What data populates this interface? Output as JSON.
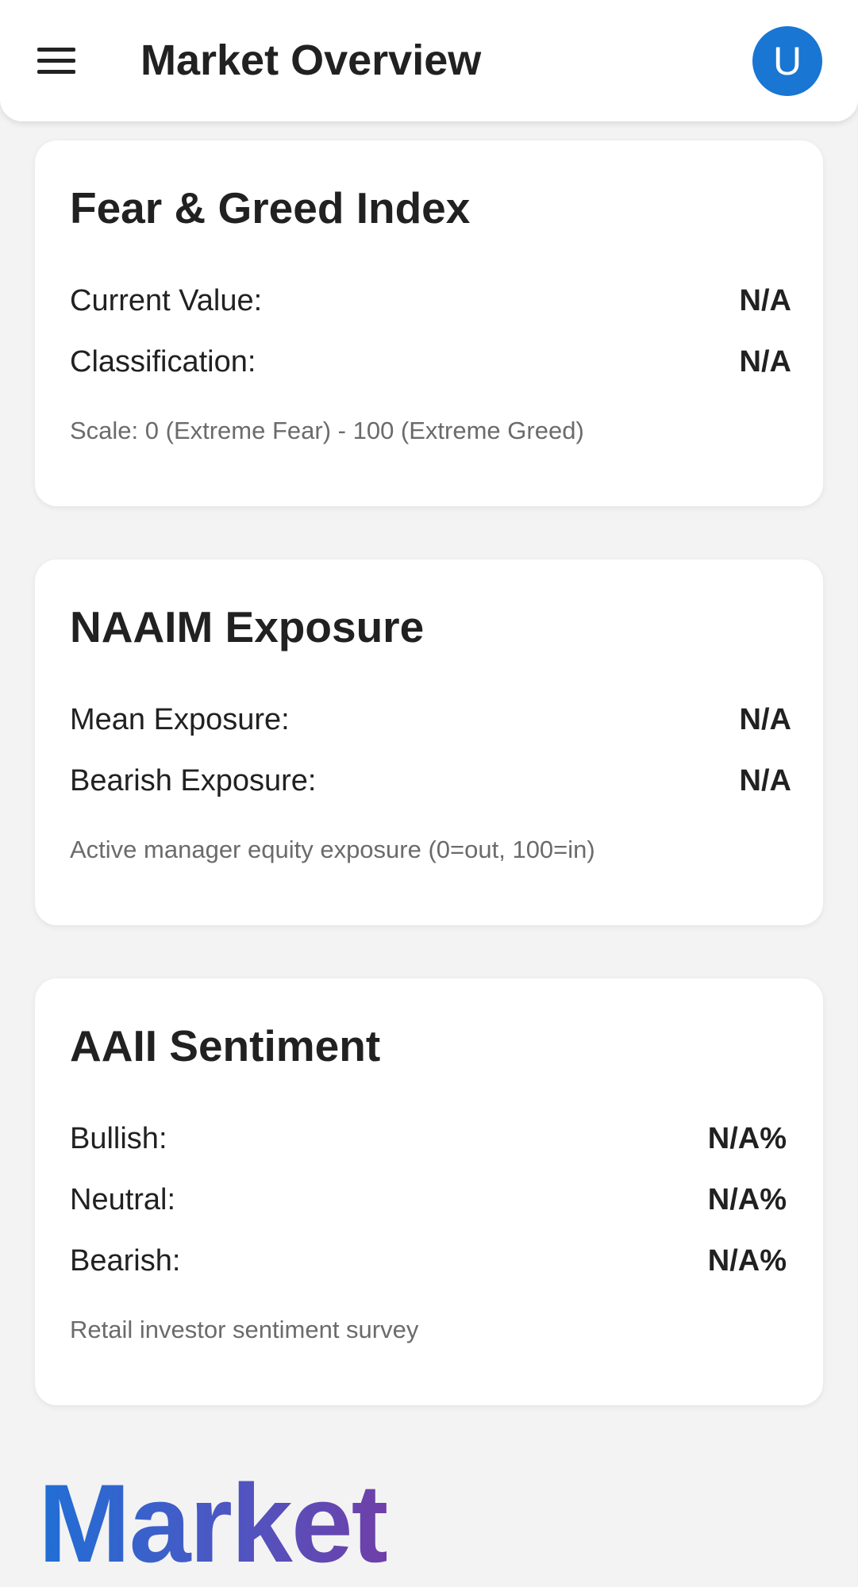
{
  "app_bar": {
    "menu_icon": "menu-icon",
    "title": "Market Overview",
    "avatar_letter": "U"
  },
  "fear_greed": {
    "title": "Fear & Greed Index",
    "rows": [
      {
        "label": "Current Value:",
        "value": "N/A"
      },
      {
        "label": "Classification:",
        "value": "N/A"
      }
    ],
    "note": "Scale: 0 (Extreme Fear) - 100 (Extreme Greed)"
  },
  "naaim": {
    "title": "NAAIM Exposure",
    "rows": [
      {
        "label": "Mean Exposure:",
        "value": "N/A"
      },
      {
        "label": "Bearish Exposure:",
        "value": "N/A"
      }
    ],
    "note": "Active manager equity exposure (0=out, 100=in)"
  },
  "aaii": {
    "title": "AAII Sentiment",
    "rows": [
      {
        "label": "Bullish:",
        "value": "N/A%"
      },
      {
        "label": "Neutral:",
        "value": "N/A%"
      },
      {
        "label": "Bearish:",
        "value": "N/A%"
      }
    ],
    "note": "Retail investor sentiment survey"
  },
  "footer": {
    "brand_text": "Market"
  },
  "colors": {
    "avatar": "#1976d2",
    "brand_gradient_start": "#1f6fd6",
    "brand_gradient_end": "#6f3fa8",
    "note_text": "#6b6b6b"
  }
}
